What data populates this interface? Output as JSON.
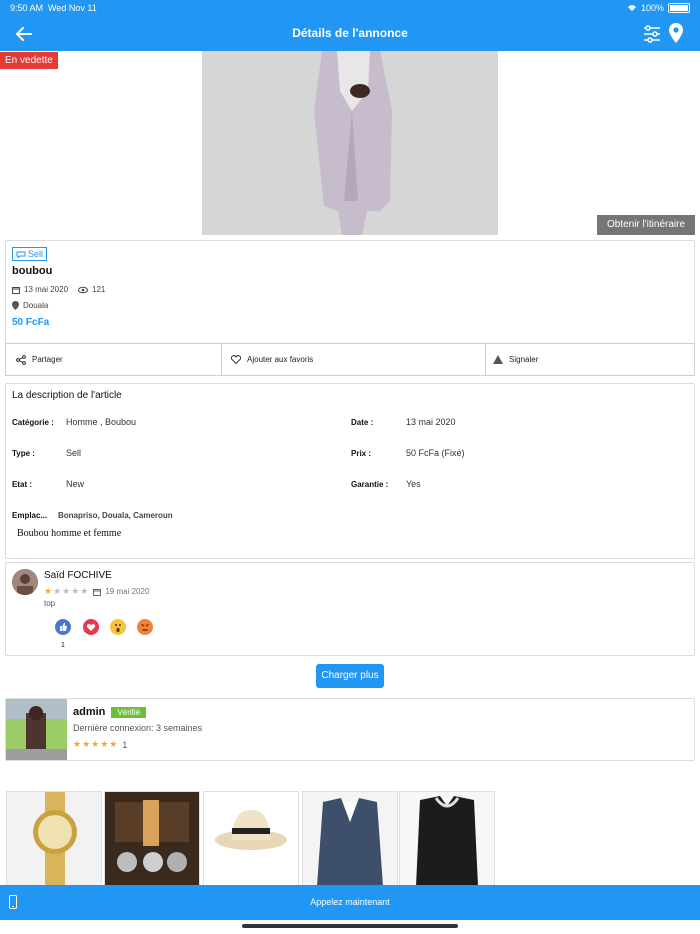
{
  "status_bar": {
    "time": "9:50 AM",
    "date": "Wed Nov 11",
    "battery": "100%"
  },
  "header": {
    "title": "Détails de l'annonce",
    "back_icon": "arrow-left-icon",
    "filter_icon": "sliders-icon",
    "location_icon": "map-pin-icon"
  },
  "photo": {
    "featured_label": "En vedette",
    "route_button": "Obtenir l'itinéraire"
  },
  "listing": {
    "tag": "Sell",
    "title": "boubou",
    "date": "13 mai 2020",
    "views": "121",
    "location": "Douala",
    "price": "50 FcFa"
  },
  "actions": [
    {
      "label": "Partager",
      "icon": "share-icon"
    },
    {
      "label": "Ajouter aux favoris",
      "icon": "heart-icon"
    },
    {
      "label": "Signaler",
      "icon": "warning-icon"
    }
  ],
  "description": {
    "title": "La description de l'article",
    "fields": {
      "categorie_label": "Catégorie :",
      "categorie": "Homme , Boubou",
      "date_label": "Date :",
      "date": "13 mai 2020",
      "type_label": "Type :",
      "type": "Sell",
      "prix_label": "Prix :",
      "prix": "50 FcFa (Fixé)",
      "etat_label": "Etat :",
      "etat": "New",
      "garantie_label": "Garantie :",
      "garantie": "Yes",
      "emplacement_label": "Emplac...",
      "emplacement": "Bonapriso, Douala, Cameroun"
    },
    "text": "Boubou homme et femme"
  },
  "review": {
    "name": "Saïd FOCHIVE",
    "rating": 1,
    "date": "19 mai 2020",
    "comment": "top",
    "reactions": [
      "like",
      "love",
      "wow",
      "angry"
    ],
    "like_count": "1"
  },
  "load_more": "Charger plus",
  "seller": {
    "name": "admin",
    "verified": "Vérifié",
    "last_seen": "Dernière connexion: 3 semaines",
    "rating": 5,
    "rating_count": "1"
  },
  "related": [
    "watch",
    "watches-case",
    "hat",
    "suit-jacket",
    "black-jacket"
  ],
  "bottom_bar": {
    "label": "Appelez maintenant",
    "icon": "phone-icon"
  },
  "colors": {
    "primary": "#2196f3",
    "featured": "#e53935",
    "verified": "#6bbf3a",
    "star": "#f5a623"
  }
}
